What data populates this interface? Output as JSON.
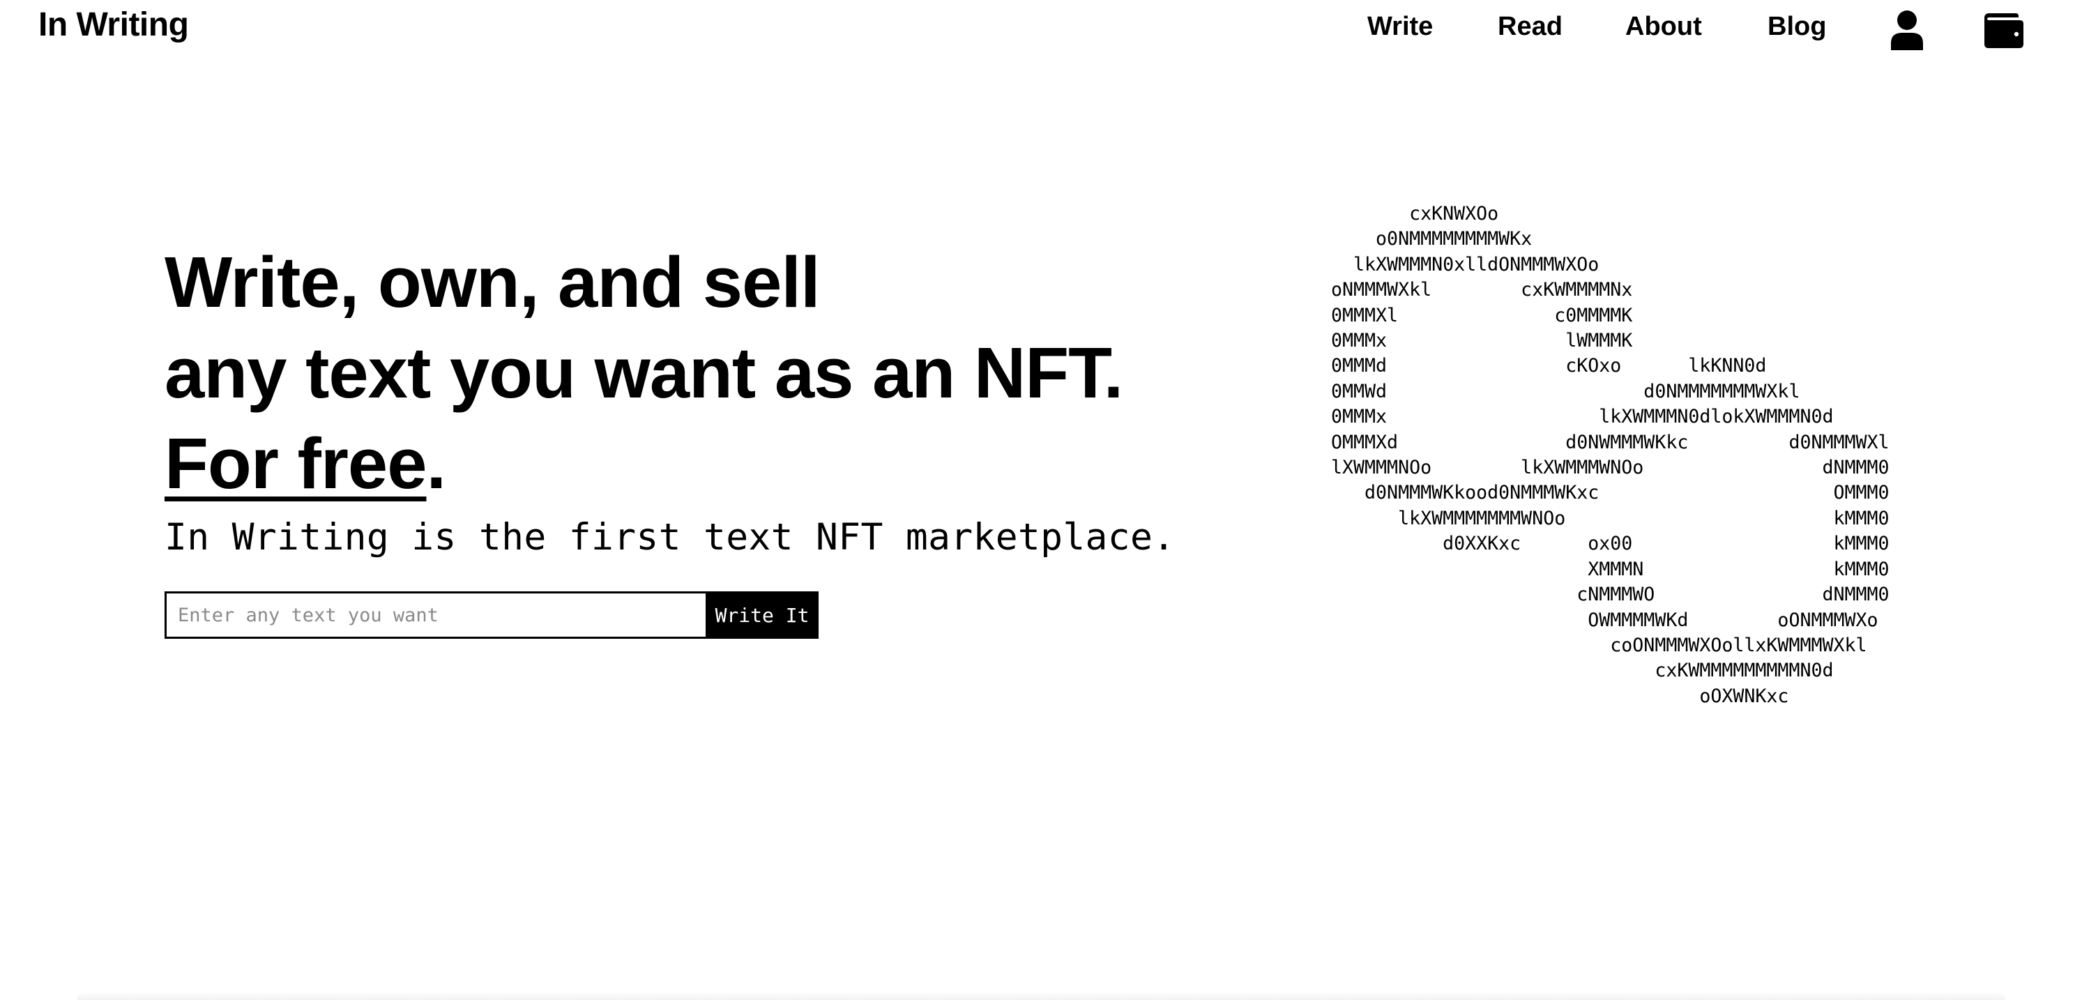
{
  "brand": {
    "name": "In Writing"
  },
  "nav": {
    "links": [
      "Write",
      "Read",
      "About",
      "Blog"
    ],
    "icons": {
      "account": "user-icon",
      "wallet": "wallet-icon"
    }
  },
  "hero": {
    "heading_line1": "Write, own, and sell",
    "heading_line2": "any text you want as an NFT.",
    "heading_line3_link": "For free",
    "heading_line3_punct": ".",
    "tagline": "In Writing is the first text NFT marketplace."
  },
  "form": {
    "input_placeholder": "Enter any text you want",
    "input_value": "",
    "button_label": "Write It"
  },
  "ascii_art": "       cxKNWXOo\n    o0NMMMMMMMMWKx\n  lkXWMMMN0xlldONMMMWXOo\noNMMMWXkl        cxKWMMMMNx\n0MMMXl              c0MMMMK\n0MMMx                lWMMMK\n0MMMd                cKOxo      lkKNN0d\n0MMWd                       d0NMMMMMMMWXkl\n0MMMx                   lkXWMMMN0dlokXWMMMN0d\nOMMMXd               d0NWMMMWKkc         d0NMMMWXl\nlXWMMMNOo        lkXWMMMWNOo                dNMMM0\n   d0NMMMWKkood0NMMMWKxc                     OMMM0\n      lkXWMMMMMMMWNOo                        kMMM0\n          d0XXKxc      ox00                  kMMM0\n                       XMMMN                 kMMM0\n                      cNMMMWO               dNMMM0\n                       OWMMMMWKd        oONMMMWXo\n                         coONMMMWXOollxKWMMMWXkl\n                             cxKWMMMMMMMMMN0d\n                                 oOXWNKxc"
}
